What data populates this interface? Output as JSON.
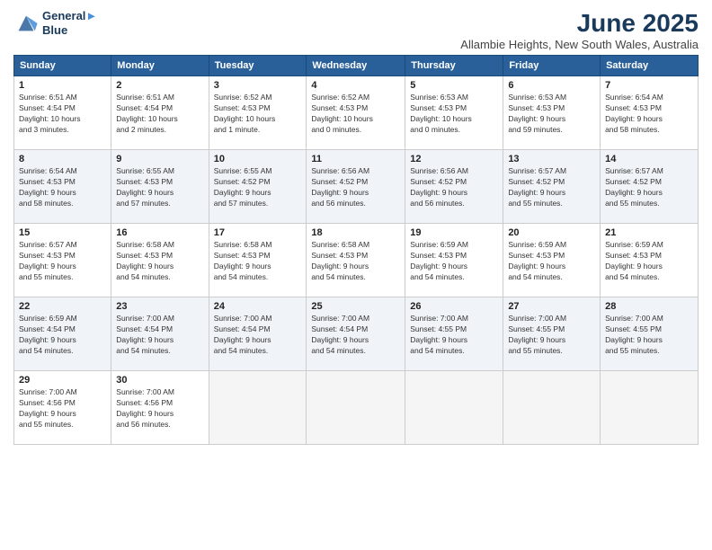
{
  "logo": {
    "line1": "General",
    "line2": "Blue"
  },
  "title": "June 2025",
  "subtitle": "Allambie Heights, New South Wales, Australia",
  "weekdays": [
    "Sunday",
    "Monday",
    "Tuesday",
    "Wednesday",
    "Thursday",
    "Friday",
    "Saturday"
  ],
  "weeks": [
    [
      {
        "day": "1",
        "info": "Sunrise: 6:51 AM\nSunset: 4:54 PM\nDaylight: 10 hours\nand 3 minutes."
      },
      {
        "day": "2",
        "info": "Sunrise: 6:51 AM\nSunset: 4:54 PM\nDaylight: 10 hours\nand 2 minutes."
      },
      {
        "day": "3",
        "info": "Sunrise: 6:52 AM\nSunset: 4:53 PM\nDaylight: 10 hours\nand 1 minute."
      },
      {
        "day": "4",
        "info": "Sunrise: 6:52 AM\nSunset: 4:53 PM\nDaylight: 10 hours\nand 0 minutes."
      },
      {
        "day": "5",
        "info": "Sunrise: 6:53 AM\nSunset: 4:53 PM\nDaylight: 10 hours\nand 0 minutes."
      },
      {
        "day": "6",
        "info": "Sunrise: 6:53 AM\nSunset: 4:53 PM\nDaylight: 9 hours\nand 59 minutes."
      },
      {
        "day": "7",
        "info": "Sunrise: 6:54 AM\nSunset: 4:53 PM\nDaylight: 9 hours\nand 58 minutes."
      }
    ],
    [
      {
        "day": "8",
        "info": "Sunrise: 6:54 AM\nSunset: 4:53 PM\nDaylight: 9 hours\nand 58 minutes."
      },
      {
        "day": "9",
        "info": "Sunrise: 6:55 AM\nSunset: 4:53 PM\nDaylight: 9 hours\nand 57 minutes."
      },
      {
        "day": "10",
        "info": "Sunrise: 6:55 AM\nSunset: 4:52 PM\nDaylight: 9 hours\nand 57 minutes."
      },
      {
        "day": "11",
        "info": "Sunrise: 6:56 AM\nSunset: 4:52 PM\nDaylight: 9 hours\nand 56 minutes."
      },
      {
        "day": "12",
        "info": "Sunrise: 6:56 AM\nSunset: 4:52 PM\nDaylight: 9 hours\nand 56 minutes."
      },
      {
        "day": "13",
        "info": "Sunrise: 6:57 AM\nSunset: 4:52 PM\nDaylight: 9 hours\nand 55 minutes."
      },
      {
        "day": "14",
        "info": "Sunrise: 6:57 AM\nSunset: 4:52 PM\nDaylight: 9 hours\nand 55 minutes."
      }
    ],
    [
      {
        "day": "15",
        "info": "Sunrise: 6:57 AM\nSunset: 4:53 PM\nDaylight: 9 hours\nand 55 minutes."
      },
      {
        "day": "16",
        "info": "Sunrise: 6:58 AM\nSunset: 4:53 PM\nDaylight: 9 hours\nand 54 minutes."
      },
      {
        "day": "17",
        "info": "Sunrise: 6:58 AM\nSunset: 4:53 PM\nDaylight: 9 hours\nand 54 minutes."
      },
      {
        "day": "18",
        "info": "Sunrise: 6:58 AM\nSunset: 4:53 PM\nDaylight: 9 hours\nand 54 minutes."
      },
      {
        "day": "19",
        "info": "Sunrise: 6:59 AM\nSunset: 4:53 PM\nDaylight: 9 hours\nand 54 minutes."
      },
      {
        "day": "20",
        "info": "Sunrise: 6:59 AM\nSunset: 4:53 PM\nDaylight: 9 hours\nand 54 minutes."
      },
      {
        "day": "21",
        "info": "Sunrise: 6:59 AM\nSunset: 4:53 PM\nDaylight: 9 hours\nand 54 minutes."
      }
    ],
    [
      {
        "day": "22",
        "info": "Sunrise: 6:59 AM\nSunset: 4:54 PM\nDaylight: 9 hours\nand 54 minutes."
      },
      {
        "day": "23",
        "info": "Sunrise: 7:00 AM\nSunset: 4:54 PM\nDaylight: 9 hours\nand 54 minutes."
      },
      {
        "day": "24",
        "info": "Sunrise: 7:00 AM\nSunset: 4:54 PM\nDaylight: 9 hours\nand 54 minutes."
      },
      {
        "day": "25",
        "info": "Sunrise: 7:00 AM\nSunset: 4:54 PM\nDaylight: 9 hours\nand 54 minutes."
      },
      {
        "day": "26",
        "info": "Sunrise: 7:00 AM\nSunset: 4:55 PM\nDaylight: 9 hours\nand 54 minutes."
      },
      {
        "day": "27",
        "info": "Sunrise: 7:00 AM\nSunset: 4:55 PM\nDaylight: 9 hours\nand 55 minutes."
      },
      {
        "day": "28",
        "info": "Sunrise: 7:00 AM\nSunset: 4:55 PM\nDaylight: 9 hours\nand 55 minutes."
      }
    ],
    [
      {
        "day": "29",
        "info": "Sunrise: 7:00 AM\nSunset: 4:56 PM\nDaylight: 9 hours\nand 55 minutes."
      },
      {
        "day": "30",
        "info": "Sunrise: 7:00 AM\nSunset: 4:56 PM\nDaylight: 9 hours\nand 56 minutes."
      },
      {
        "day": "",
        "info": ""
      },
      {
        "day": "",
        "info": ""
      },
      {
        "day": "",
        "info": ""
      },
      {
        "day": "",
        "info": ""
      },
      {
        "day": "",
        "info": ""
      }
    ]
  ]
}
